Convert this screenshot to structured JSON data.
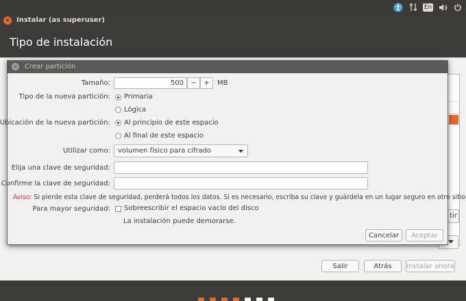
{
  "top_panel": {
    "tray": {
      "accessibility": "accessibility-icon",
      "network": "network-arrows-icon",
      "keyboard_layout": "En",
      "volume": "volume-icon",
      "power": "power-icon"
    }
  },
  "window": {
    "title": "Instalar (as superuser)",
    "page_title": "Tipo de instalación"
  },
  "background": {
    "partial_button": "tir",
    "buttons": {
      "quit": "Salir",
      "back": "Atrás",
      "install_now": "Instalar ahora"
    }
  },
  "dialog": {
    "title": "Crear partición",
    "size": {
      "label": "Tamaño:",
      "value": "500",
      "minus": "−",
      "plus": "+",
      "unit": "MB"
    },
    "type": {
      "label": "Tipo de la nueva partición:",
      "options": [
        "Primaria",
        "Lógica"
      ],
      "selected": "Primaria"
    },
    "location": {
      "label": "Ubicación de la nueva partición:",
      "options": [
        "Al principio de este espacio",
        "Al final de este espacio"
      ],
      "selected": "Al principio de este espacio"
    },
    "use_as": {
      "label": "Utilizar como:",
      "value": "volumen físico para cifrado"
    },
    "key": {
      "label": "Elija una clave de seguridad:",
      "value": ""
    },
    "confirm_key": {
      "label": "Confirme la clave de seguridad:",
      "value": ""
    },
    "warning": {
      "prefix": "Aviso:",
      "text": "Si pierde esta clave de seguridad, perderá todos los datos. Si es necesario, escriba su clave y guárdela en un lugar seguro en otro sitio."
    },
    "security": {
      "label": "Para mayor seguridad:",
      "checkbox_label": "Sobreescribir el espacio vacío del disco",
      "checked": false,
      "note": "La instalación puede demorarse."
    },
    "buttons": {
      "cancel": "Cancelar",
      "accept": "Aceptar"
    }
  },
  "progress": {
    "total_steps": 7,
    "completed_steps": 4
  },
  "colors": {
    "accent": "#e9662c",
    "panel": "#3c3b37",
    "dialog_bg": "#f2f1f0",
    "warning": "#c0392b"
  }
}
